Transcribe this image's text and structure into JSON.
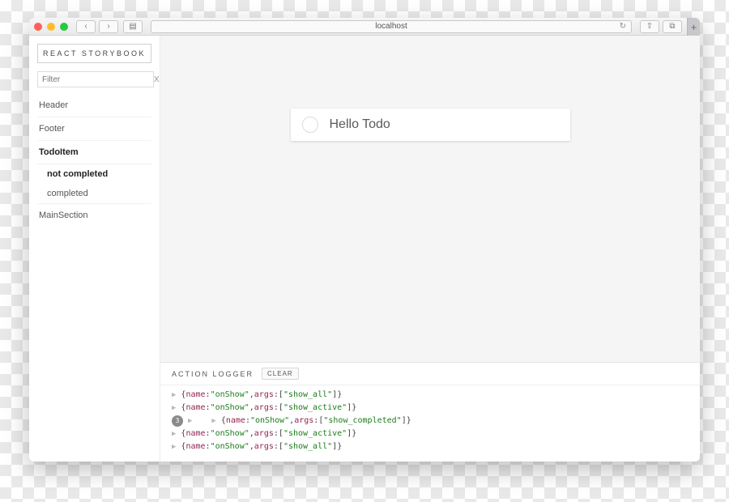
{
  "browser": {
    "address": "localhost",
    "newtab_glyph": "+"
  },
  "sidebar": {
    "brand": "REACT STORYBOOK",
    "filter_placeholder": "Filter",
    "clear_glyph": "X",
    "items": [
      {
        "label": "Header",
        "bold": false
      },
      {
        "label": "Footer",
        "bold": false
      },
      {
        "label": "TodoItem",
        "bold": true
      },
      {
        "label": "MainSection",
        "bold": false
      }
    ],
    "todo_sub": [
      {
        "label": "not completed",
        "bold": true
      },
      {
        "label": "completed",
        "bold": false
      }
    ]
  },
  "preview": {
    "todo_text": "Hello Todo"
  },
  "logger": {
    "title": "ACTION LOGGER",
    "clear_label": "CLEAR",
    "badge": "3",
    "entries": [
      {
        "name": "onShow",
        "arg": "show_all",
        "indent": 0,
        "badge": false
      },
      {
        "name": "onShow",
        "arg": "show_active",
        "indent": 0,
        "badge": false
      },
      {
        "name": "onShow",
        "arg": "show_completed",
        "indent": 1,
        "badge": true
      },
      {
        "name": "onShow",
        "arg": "show_active",
        "indent": 0,
        "badge": false
      },
      {
        "name": "onShow",
        "arg": "show_all",
        "indent": 0,
        "badge": false
      }
    ]
  }
}
